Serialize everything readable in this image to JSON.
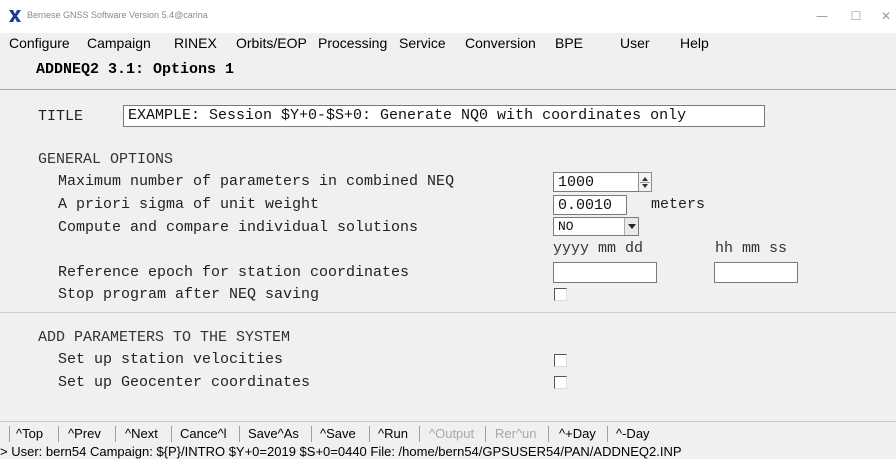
{
  "window": {
    "title": "Bernese GNSS Software Version 5.4@carina",
    "minimize_glyph": "—",
    "maximize_glyph": "☐",
    "close_glyph": "✕"
  },
  "menubar": {
    "items": [
      "Configure",
      "Campaign",
      "RINEX",
      "Orbits/EOP",
      "Processing",
      "Service",
      "Conversion",
      "BPE",
      "User",
      "Help"
    ]
  },
  "panel": {
    "heading": "ADDNEQ2 3.1: Options 1",
    "title_label": "TITLE",
    "title_value": "EXAMPLE: Session $Y+0-$S+0: Generate NQ0 with coordinates only",
    "general": {
      "heading": "GENERAL OPTIONS",
      "max_params_label": "Maximum number of parameters in combined NEQ",
      "max_params_value": "1000",
      "sigma_label": "A priori sigma of unit weight",
      "sigma_value": "0.0010",
      "sigma_unit": "meters",
      "compute_label": "Compute and compare individual solutions",
      "compute_value": "NO",
      "date_header": "yyyy mm dd",
      "time_header": "hh mm ss",
      "ref_epoch_label": "Reference epoch for station coordinates",
      "ref_epoch_date": "",
      "ref_epoch_time": "",
      "stop_label": "Stop program after NEQ saving",
      "stop_checked": false
    },
    "add_params": {
      "heading": "ADD PARAMETERS TO THE SYSTEM",
      "velocities_label": "Set up station velocities",
      "velocities_checked": false,
      "geocenter_label": "Set up Geocenter coordinates",
      "geocenter_checked": false
    }
  },
  "toolbar": {
    "top": "^Top",
    "prev": "^Prev",
    "next": "^Next",
    "cancel": "Cance^l",
    "save_as": "Save^As",
    "save": "^Save",
    "run": "^Run",
    "output": "^Output",
    "rerun": "Rer^un",
    "plus_day": "^+Day",
    "minus_day": "^-Day"
  },
  "status": {
    "text": "> User: bern54  Campaign: ${P}/INTRO  $Y+0=2019  $S+0=0440  File: /home/bern54/GPSUSER54/PAN/ADDNEQ2.INP"
  },
  "colors": {
    "background": "#f0f0f0",
    "divider": "#9aa6c8",
    "app_icon": "#1d3c8f",
    "disabled_text": "#a8a8a8"
  }
}
